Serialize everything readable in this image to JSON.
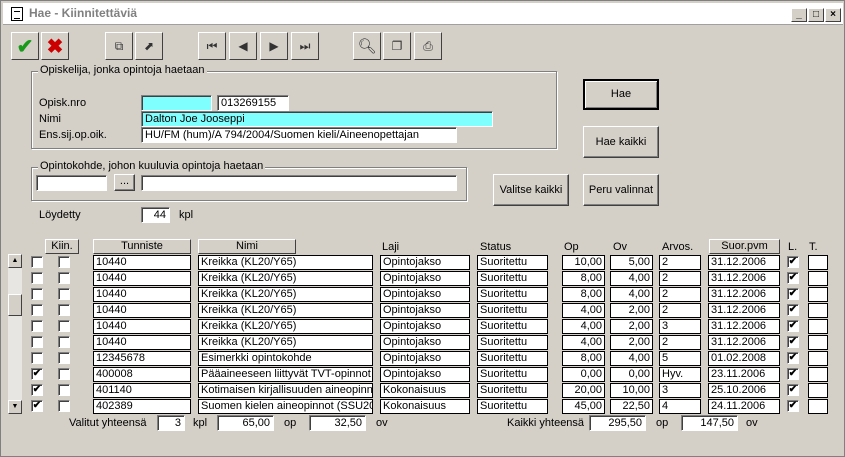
{
  "window": {
    "title": "Hae - Kiinnitettäviä"
  },
  "student_group": {
    "legend": "Opiskelija, jonka opintoja haetaan",
    "nro_label": "Opisk.nro",
    "nro_value": "",
    "nro_value2": "013269155",
    "name_label": "Nimi",
    "name_value": "Dalton Joe Jooseppi",
    "ens_label": "Ens.sij.op.oik.",
    "ens_value": "HU/FM (hum)/A 794/2004/Suomen kieli/Aineenopettajan"
  },
  "course_group": {
    "legend": "Opintokohde, johon kuuluvia opintoja haetaan",
    "code_value": "",
    "browse_label": "...",
    "name_value": ""
  },
  "buttons": {
    "hae": "Hae",
    "hae_kaikki": "Hae kaikki",
    "valitse_kaikki": "Valitse kaikki",
    "peru_valinnat": "Peru valinnat"
  },
  "found": {
    "label": "Löydetty",
    "count": "44",
    "unit": "kpl"
  },
  "columns": {
    "kiin": "Kiin.",
    "tunniste": "Tunniste",
    "nimi": "Nimi",
    "laji": "Laji",
    "status": "Status",
    "op": "Op",
    "ov": "Ov",
    "arvos": "Arvos.",
    "suor": "Suor.pvm",
    "l": "L.",
    "t": "T."
  },
  "rows": [
    {
      "sel": false,
      "kiin": false,
      "tunniste": "10440",
      "nimi": "Kreikka (KL20/Y65)",
      "laji": "Opintojakso",
      "status": "Suoritettu",
      "op": "10,00",
      "ov": "5,00",
      "arvos": "2",
      "pvm": "31.12.2006",
      "l": true
    },
    {
      "sel": false,
      "kiin": false,
      "tunniste": "10440",
      "nimi": "Kreikka (KL20/Y65)",
      "laji": "Opintojakso",
      "status": "Suoritettu",
      "op": "8,00",
      "ov": "4,00",
      "arvos": "2",
      "pvm": "31.12.2006",
      "l": true
    },
    {
      "sel": false,
      "kiin": false,
      "tunniste": "10440",
      "nimi": "Kreikka (KL20/Y65)",
      "laji": "Opintojakso",
      "status": "Suoritettu",
      "op": "8,00",
      "ov": "4,00",
      "arvos": "2",
      "pvm": "31.12.2006",
      "l": true
    },
    {
      "sel": false,
      "kiin": false,
      "tunniste": "10440",
      "nimi": "Kreikka (KL20/Y65)",
      "laji": "Opintojakso",
      "status": "Suoritettu",
      "op": "4,00",
      "ov": "2,00",
      "arvos": "2",
      "pvm": "31.12.2006",
      "l": true
    },
    {
      "sel": false,
      "kiin": false,
      "tunniste": "10440",
      "nimi": "Kreikka (KL20/Y65)",
      "laji": "Opintojakso",
      "status": "Suoritettu",
      "op": "4,00",
      "ov": "2,00",
      "arvos": "3",
      "pvm": "31.12.2006",
      "l": true
    },
    {
      "sel": false,
      "kiin": false,
      "tunniste": "10440",
      "nimi": "Kreikka (KL20/Y65)",
      "laji": "Opintojakso",
      "status": "Suoritettu",
      "op": "4,00",
      "ov": "2,00",
      "arvos": "2",
      "pvm": "31.12.2006",
      "l": true
    },
    {
      "sel": false,
      "kiin": false,
      "tunniste": "12345678",
      "nimi": "Esimerkki opintokohde",
      "laji": "Opintojakso",
      "status": "Suoritettu",
      "op": "8,00",
      "ov": "4,00",
      "arvos": "5",
      "pvm": "01.02.2008",
      "l": true
    },
    {
      "sel": true,
      "kiin": false,
      "tunniste": "400008",
      "nimi": "Pääaineeseen liittyvät TVT-opinnot (",
      "laji": "Opintojakso",
      "status": "Suoritettu",
      "op": "0,00",
      "ov": "0,00",
      "arvos": "Hyv.",
      "pvm": "23.11.2006",
      "l": true
    },
    {
      "sel": true,
      "kiin": false,
      "tunniste": "401140",
      "nimi": "Kotimaisen kirjallisuuden aineopinno",
      "laji": "Kokonaisuus",
      "status": "Suoritettu",
      "op": "20,00",
      "ov": "10,00",
      "arvos": "3",
      "pvm": "25.10.2006",
      "l": true
    },
    {
      "sel": true,
      "kiin": false,
      "tunniste": "402389",
      "nimi": "Suomen kielen aineopinnot (SSU200",
      "laji": "Kokonaisuus",
      "status": "Suoritettu",
      "op": "45,00",
      "ov": "22,50",
      "arvos": "4",
      "pvm": "24.11.2006",
      "l": true
    }
  ],
  "totals": {
    "valitut_label": "Valitut yhteensä",
    "valitut_count": "3",
    "kpl": "kpl",
    "valitut_op": "65,00",
    "op_label": "op",
    "valitut_ov": "32,50",
    "ov_label": "ov",
    "kaikki_label": "Kaikki yhteensä",
    "kaikki_op": "295,50",
    "kaikki_ov": "147,50"
  }
}
